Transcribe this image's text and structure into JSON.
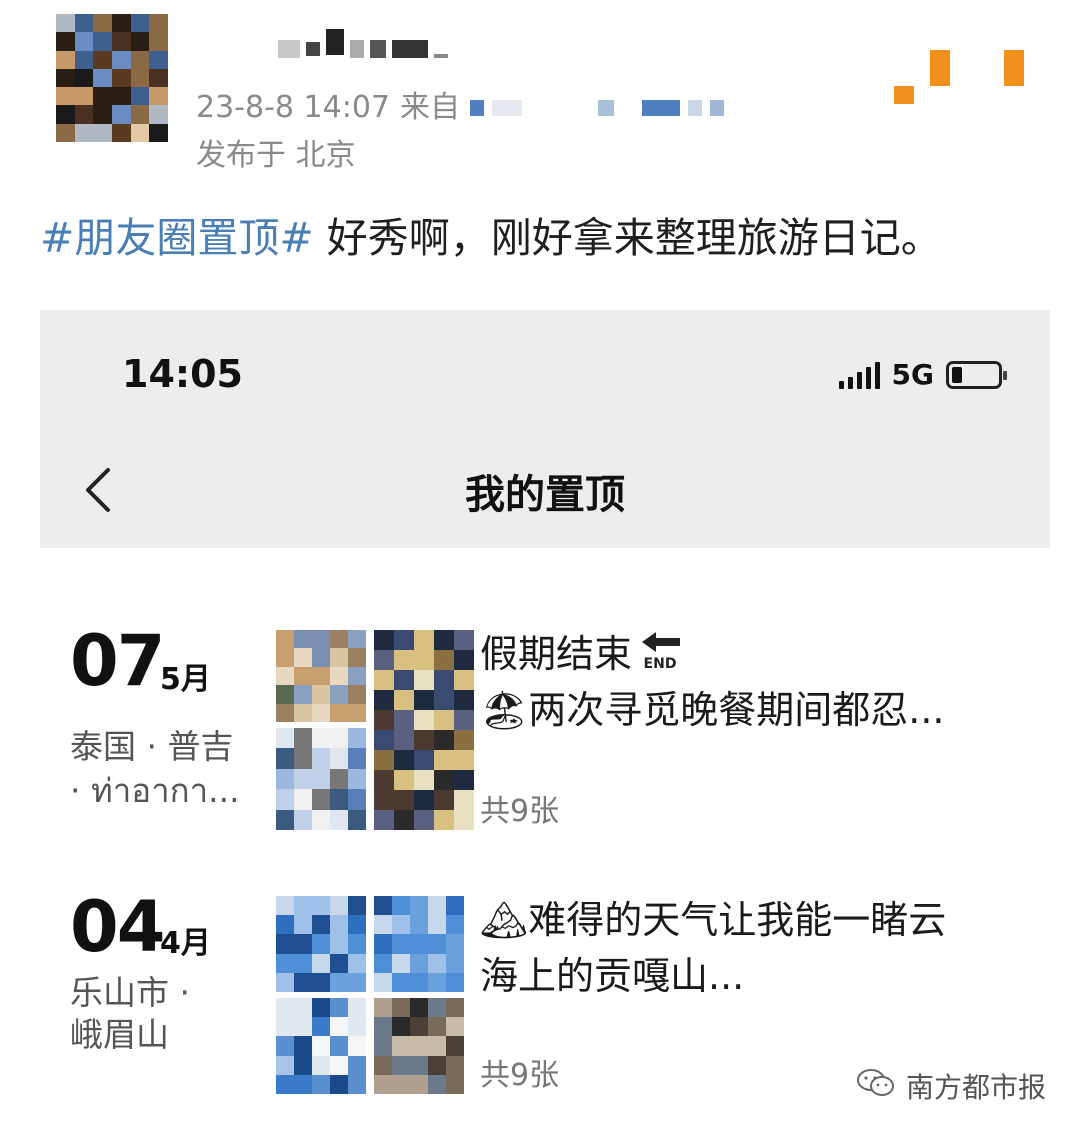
{
  "post": {
    "timestamp": "23-8-8 14:07",
    "source_prefix": "来自",
    "location": "发布于 北京",
    "hashtag": "#朋友圈置顶#",
    "text": " 好秀啊，刚好拿来整理旅游日记。"
  },
  "screenshot": {
    "status_bar": {
      "time": "14:05",
      "network": "5G"
    },
    "page_title": "我的置顶",
    "entries": [
      {
        "day": "07",
        "month": "5月",
        "place_line1": "泰国 · 普吉",
        "place_line2": "· ท่าอากา...",
        "title_line1": "假期结束",
        "title_line2": "两次寻觅晚餐期间都忍...",
        "emoji1": "🔙",
        "emoji2": "🏖",
        "count": "共9张"
      },
      {
        "day": "04",
        "month": "4月",
        "place_line1": "乐山市 ·",
        "place_line2": "峨眉山",
        "title_line1": "难得的天气让我能一睹云",
        "title_line2": "海上的贡嘎山...",
        "emoji1": "🏔",
        "count": "共9张"
      }
    ]
  },
  "watermark": "南方都市报",
  "colors": {
    "hashtag": "#4a7fb5",
    "menu_accent": "#f2901c",
    "nav_bg": "#ededed"
  }
}
